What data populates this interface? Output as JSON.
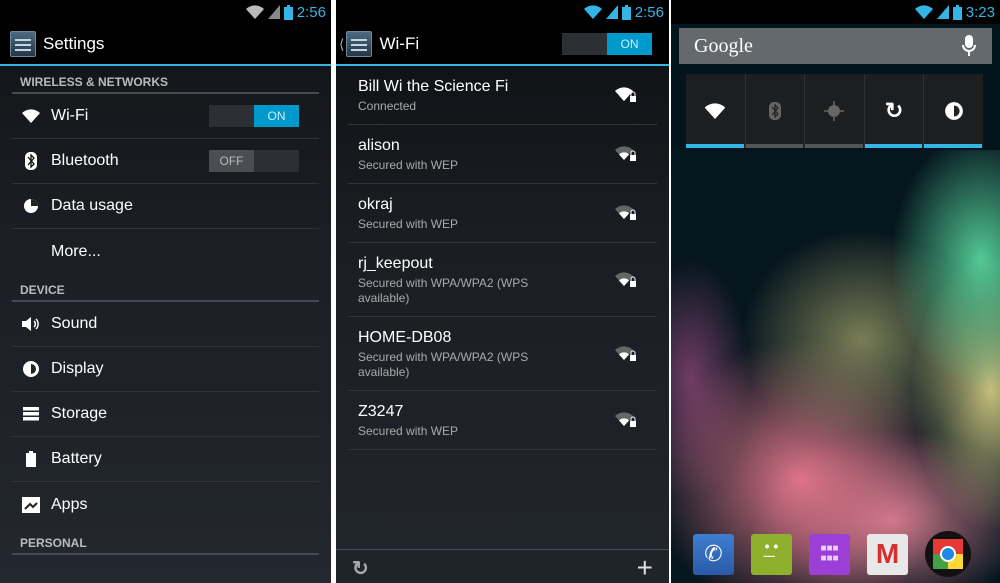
{
  "settings_panel": {
    "status": {
      "time": "2:56"
    },
    "title": "Settings",
    "sections": [
      {
        "header": "WIRELESS & NETWORKS",
        "items": [
          {
            "label": "Wi-Fi",
            "icon": "wifi-icon",
            "toggle": "ON"
          },
          {
            "label": "Bluetooth",
            "icon": "bluetooth-icon",
            "toggle": "OFF"
          },
          {
            "label": "Data usage",
            "icon": "data-usage-icon"
          },
          {
            "label": "More..."
          }
        ]
      },
      {
        "header": "DEVICE",
        "items": [
          {
            "label": "Sound",
            "icon": "sound-icon"
          },
          {
            "label": "Display",
            "icon": "display-icon"
          },
          {
            "label": "Storage",
            "icon": "storage-icon"
          },
          {
            "label": "Battery",
            "icon": "battery-icon"
          },
          {
            "label": "Apps",
            "icon": "apps-icon"
          }
        ]
      },
      {
        "header": "PERSONAL",
        "items": []
      }
    ]
  },
  "wifi_panel": {
    "status": {
      "time": "2:56"
    },
    "title": "Wi-Fi",
    "toggle": "ON",
    "networks": [
      {
        "name": "Bill Wi the Science Fi",
        "status": "Connected"
      },
      {
        "name": "alison",
        "status": "Secured with WEP"
      },
      {
        "name": "okraj",
        "status": "Secured with WEP"
      },
      {
        "name": "rj_keepout",
        "status": "Secured with WPA/WPA2 (WPS available)"
      },
      {
        "name": "HOME-DB08",
        "status": "Secured with WPA/WPA2 (WPS available)"
      },
      {
        "name": "Z3247",
        "status": "Secured with WEP"
      }
    ]
  },
  "home_panel": {
    "status": {
      "time": "3:23"
    },
    "search_label": "Google",
    "quick_settings": [
      {
        "name": "wifi",
        "active": true
      },
      {
        "name": "bluetooth",
        "active": false
      },
      {
        "name": "gps",
        "active": false
      },
      {
        "name": "sync",
        "active": true
      },
      {
        "name": "brightness",
        "active": true
      }
    ],
    "dock": [
      "phone",
      "messaging",
      "app-drawer",
      "gmail",
      "chrome"
    ]
  },
  "colors": {
    "accent": "#33b5e5",
    "toggle_on": "#0099cc"
  }
}
